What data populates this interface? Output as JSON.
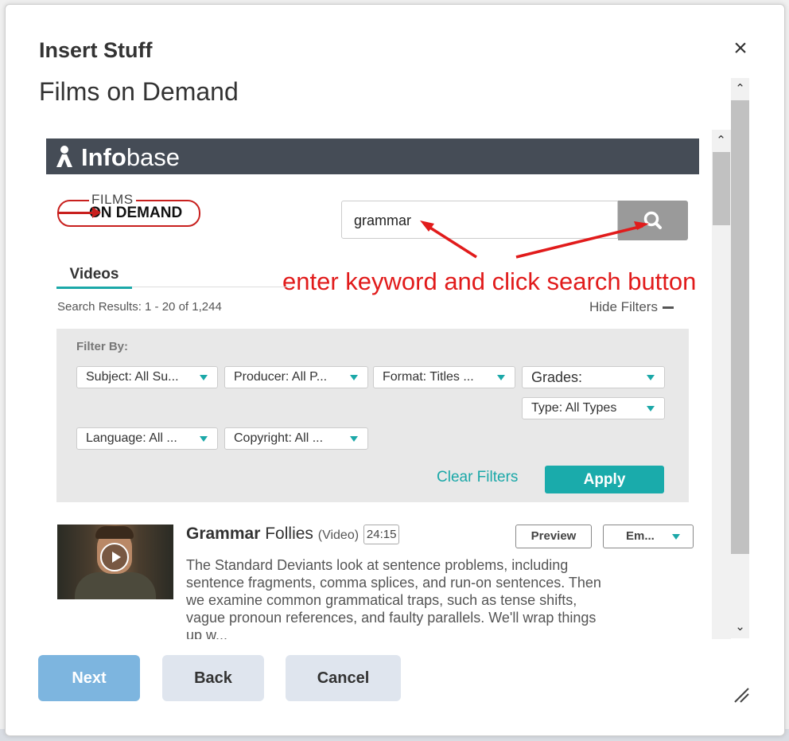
{
  "dialog": {
    "title": "Insert Stuff",
    "close_label": "×",
    "panel_title": "Films on Demand"
  },
  "brand": {
    "name_bold": "Info",
    "name_rest": "base",
    "fod_top": "FILMS",
    "fod_bottom": "ON DEMAND"
  },
  "search": {
    "value": "grammar",
    "icon": "search-icon"
  },
  "annotation": {
    "text": "enter keyword and click search button",
    "color": "#e11b1b"
  },
  "tabs": [
    {
      "label": "Videos",
      "active": true
    }
  ],
  "results_summary": "Search Results: 1 - 20 of 1,244",
  "hide_filters_label": "Hide Filters",
  "filters": {
    "label": "Filter By:",
    "subject": "Subject: All Su...",
    "producer": "Producer: All P...",
    "format": "Format: Titles ...",
    "grades": "Grades:",
    "type": "Type: All Types",
    "language": "Language: All ...",
    "copyright": "Copyright: All ...",
    "clear_label": "Clear Filters",
    "apply_label": "Apply"
  },
  "result": {
    "title_bold": "Grammar",
    "title_rest": " Follies",
    "type": "(Video)",
    "duration": "24:15",
    "preview_label": "Preview",
    "embed_label": "Em...",
    "description": "The Standard Deviants look at sentence problems, including sentence fragments, comma splices, and run-on sentences. Then we examine common grammatical traps, such as tense shifts, vague pronoun references, and faulty parallels. We'll wrap things up w..."
  },
  "footer": {
    "next_label": "Next",
    "back_label": "Back",
    "cancel_label": "Cancel"
  },
  "colors": {
    "accent": "#1aabab",
    "header_bar": "#454c56",
    "primary_button": "#7db5df"
  }
}
